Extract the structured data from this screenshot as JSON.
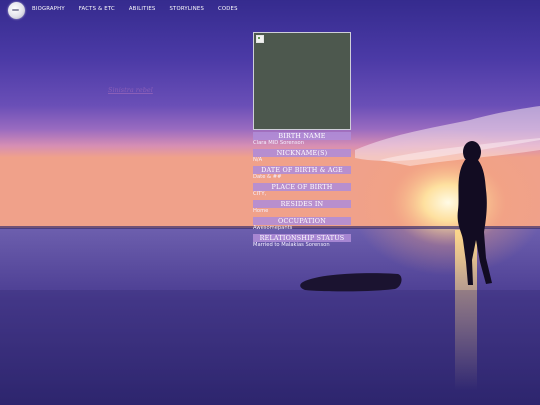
{
  "nav": {
    "items": [
      "BIOGRAPHY",
      "FACTS & ETC",
      "ABILITIES",
      "STORYLINES",
      "CODES"
    ]
  },
  "signature": "Sinistra rebel",
  "profile": {
    "rows": [
      {
        "label": "BIRTH NAME",
        "value": "Clara MID Sorenson"
      },
      {
        "label": "NICKNAME(S)",
        "value": "N/A"
      },
      {
        "label": "DATE OF BIRTH & AGE",
        "value": "Date & ##"
      },
      {
        "label": "PLACE OF BIRTH",
        "value": "CITY,"
      },
      {
        "label": "RESIDES IN",
        "value": "Home"
      },
      {
        "label": "OCCUPATION",
        "value": "Awesomepants"
      },
      {
        "label": "RELATIONSHIP STATUS",
        "value": "Married to Malakias Sorenson"
      }
    ]
  },
  "colors": {
    "header_bar": "#AF8CD7",
    "sky_top": "#3A2A8C",
    "sea": "#6B5BA8"
  }
}
